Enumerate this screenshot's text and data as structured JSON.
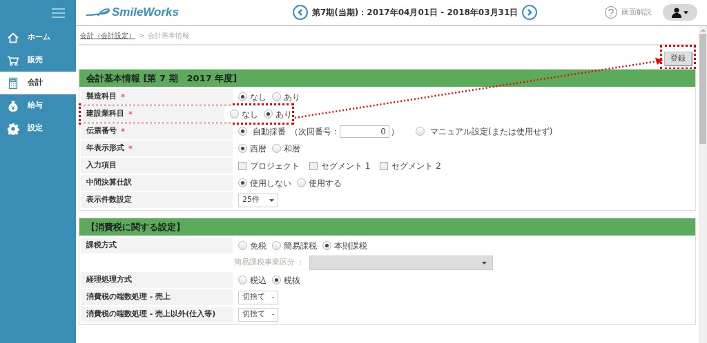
{
  "header": {
    "logo": "SmileWorks",
    "period": "第7期(当期)：2017年04月01日 - 2018年03月31日",
    "help": "画面解説"
  },
  "sidebar": {
    "items": [
      {
        "label": "ホーム",
        "kind": "home",
        "selected": false
      },
      {
        "label": "販売",
        "kind": "cart",
        "selected": false
      },
      {
        "label": "会計",
        "kind": "calculator",
        "selected": true
      },
      {
        "label": "給与",
        "kind": "moneybag",
        "selected": false
      },
      {
        "label": "設定",
        "kind": "gear",
        "selected": false
      }
    ]
  },
  "breadcrumb": [
    {
      "label": "会計（会計設定）",
      "kind": "link"
    },
    {
      "label": ">",
      "kind": "text"
    },
    {
      "label": "会計基本情報",
      "kind": "text"
    }
  ],
  "save_button": {
    "label": "登録",
    "highlighted": true
  },
  "sections": [
    {
      "title": "会計基本情報 [第 7 期　2017 年度]",
      "rows": [
        {
          "kind": "radio",
          "label": "製造科目",
          "required_mark": "*",
          "highlighted": false,
          "options": [
            {
              "label": "なし",
              "selected": true
            },
            {
              "label": "あり",
              "selected": false
            }
          ]
        },
        {
          "kind": "radio",
          "label": "建設業科目",
          "required_mark": "*",
          "highlighted": true,
          "options": [
            {
              "label": "なし",
              "selected": false
            },
            {
              "label": "あり",
              "selected": true
            }
          ]
        },
        {
          "kind": "numbering",
          "label": "伝票番号",
          "required_mark": "*",
          "highlighted": false,
          "auto": {
            "label": "自動採番",
            "selected": true,
            "prefix": "（次回番号：",
            "value": "0",
            "suffix": "）"
          },
          "manual": {
            "label": "マニュアル設定(または使用せず)",
            "selected": false
          }
        },
        {
          "kind": "radio",
          "label": "年表示形式",
          "required_mark": "*",
          "highlighted": false,
          "options": [
            {
              "label": "西暦",
              "selected": true
            },
            {
              "label": "和暦",
              "selected": false
            }
          ]
        },
        {
          "kind": "checkbox",
          "label": "入力項目",
          "highlighted": false,
          "options": [
            {
              "label": "プロジェクト",
              "checked": false
            },
            {
              "label": "セグメント 1",
              "checked": false
            },
            {
              "label": "セグメント 2",
              "checked": false
            }
          ]
        },
        {
          "kind": "radio",
          "label": "中間決算仕訳",
          "highlighted": false,
          "options": [
            {
              "label": "使用しない",
              "selected": true
            },
            {
              "label": "使用する",
              "selected": false
            }
          ]
        },
        {
          "kind": "select",
          "label": "表示件数設定",
          "highlighted": false,
          "value": "25件"
        }
      ]
    },
    {
      "title": "【消費税に関する設定】",
      "rows": [
        {
          "kind": "radio",
          "label": "課税方式",
          "highlighted": false,
          "options": [
            {
              "label": "免税",
              "selected": false
            },
            {
              "label": "簡易課税",
              "selected": false
            },
            {
              "label": "本則課税",
              "selected": true
            }
          ]
        },
        {
          "kind": "subselect",
          "sublabel": "簡易課税事業区分 ：",
          "disabled": true,
          "highlighted": false
        },
        {
          "kind": "radio",
          "label": "経理処理方式",
          "highlighted": false,
          "options": [
            {
              "label": "税込",
              "selected": false
            },
            {
              "label": "税抜",
              "selected": true
            }
          ]
        },
        {
          "kind": "select",
          "label": "消費税の端数処理 - 売上",
          "highlighted": false,
          "value": "切捨て"
        },
        {
          "kind": "select",
          "label": "消費税の端数処理 - 売上以外(仕入等)",
          "highlighted": false,
          "value": "切捨て"
        }
      ]
    }
  ]
}
